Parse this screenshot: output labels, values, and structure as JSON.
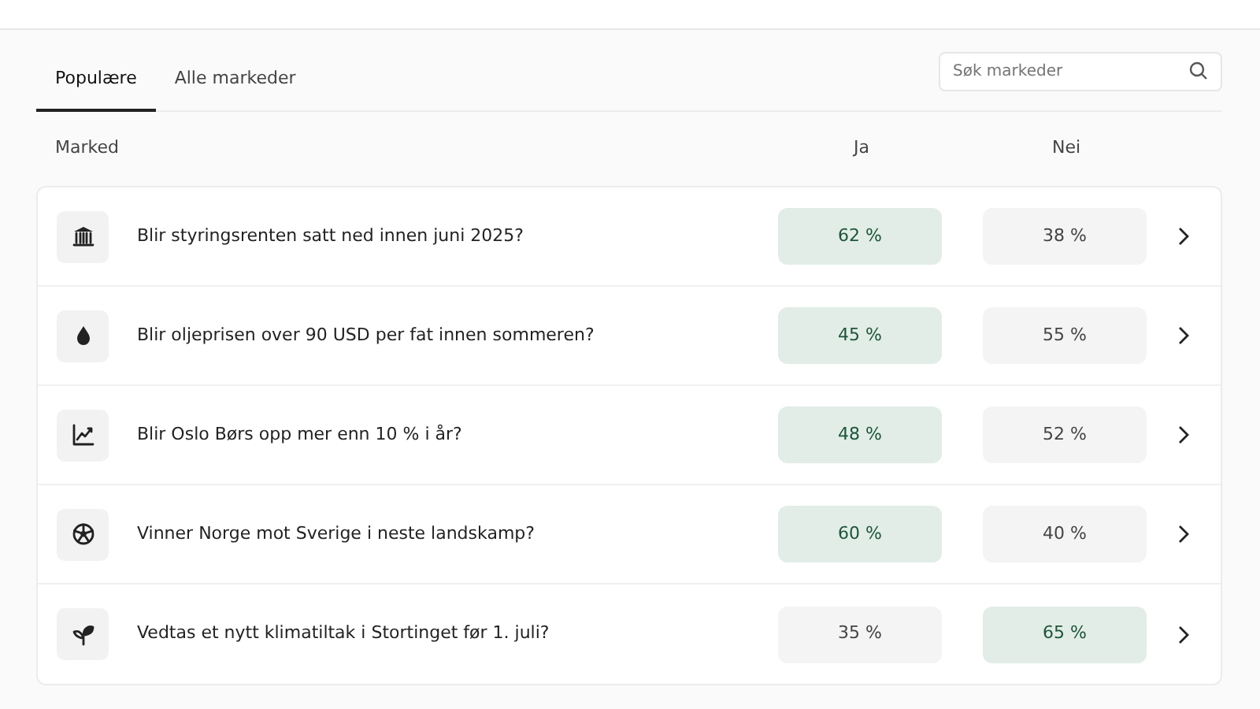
{
  "tabs": [
    {
      "label": "Populære",
      "selected": true
    },
    {
      "label": "Alle markeder",
      "selected": false
    }
  ],
  "search": {
    "placeholder": "Søk markeder"
  },
  "table": {
    "columns": [
      "Marked",
      "Ja",
      "Nei"
    ],
    "rows": [
      {
        "question": "Blir styringsrenten satt ned innen juni 2025?",
        "ja": {
          "text": "62 %",
          "highlighted": true
        },
        "nei": {
          "text": "38 %",
          "highlighted": false
        }
      },
      {
        "question": "Blir oljeprisen over 90 USD per fat innen sommeren?",
        "ja": {
          "text": "45 %",
          "highlighted": true
        },
        "nei": {
          "text": "55 %",
          "highlighted": false
        }
      },
      {
        "question": "Blir Oslo Børs opp mer enn 10 % i år?",
        "ja": {
          "text": "48 %",
          "highlighted": true
        },
        "nei": {
          "text": "52 %",
          "highlighted": false
        }
      },
      {
        "question": "Vinner Norge mot Sverige i neste landskamp?",
        "ja": {
          "text": "60 %",
          "highlighted": true
        },
        "nei": {
          "text": "40 %",
          "highlighted": false
        }
      },
      {
        "question": "Vedtas et nytt klimatiltak i Stortinget før 1. juli?",
        "ja": {
          "text": "35 %",
          "highlighted": false
        },
        "nei": {
          "text": "65 %",
          "highlighted": true
        }
      }
    ]
  }
}
